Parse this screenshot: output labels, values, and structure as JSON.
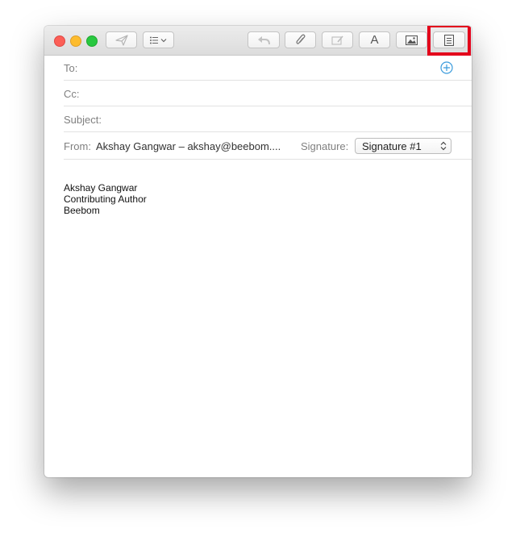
{
  "toolbar": {
    "send_icon": "paper-plane-icon",
    "header_fields_icon": "list-dropdown-icon",
    "reply_icon": "reply-arrow-icon",
    "attach_icon": "paperclip-icon",
    "markup_icon": "markup-pen-icon",
    "format_label": "A",
    "photo_icon": "photo-browser-icon",
    "stationery_icon": "stationery-icon"
  },
  "fields": {
    "to_label": "To:",
    "cc_label": "Cc:",
    "subject_label": "Subject:",
    "from_label": "From:",
    "from_value": "Akshay Gangwar – akshay@beebom....",
    "signature_label": "Signature:",
    "signature_value": "Signature #1"
  },
  "message": {
    "lines": [
      "Akshay Gangwar",
      "Contributing Author",
      "Beebom"
    ]
  },
  "colors": {
    "highlight": "#e3001b",
    "close": "#fc5f57",
    "minimize": "#fdbc2e",
    "zoom": "#28c840",
    "add_contact": "#3a9bdc"
  }
}
